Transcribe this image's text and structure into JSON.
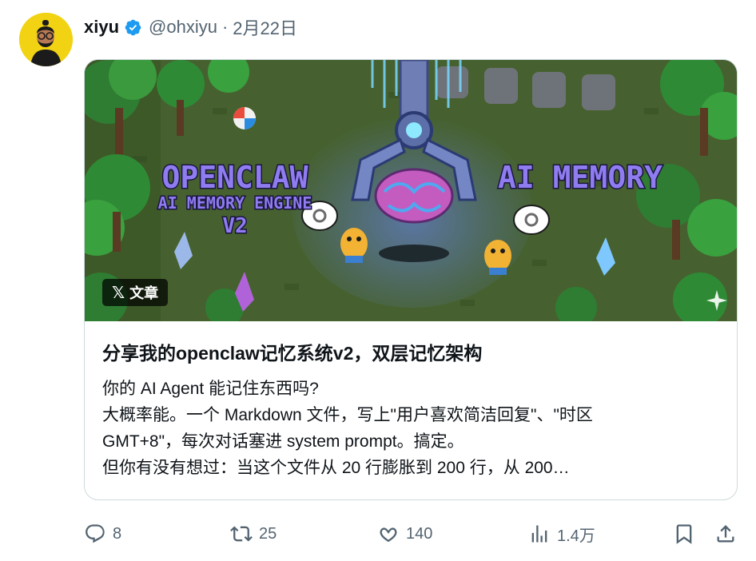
{
  "author": {
    "name": "xiyu",
    "handle": "@ohxiyu",
    "separator": "·",
    "date": "2月22日",
    "verified": true
  },
  "card": {
    "badge": {
      "icon": "x-logo-icon",
      "label": "文章"
    },
    "banner_text": {
      "left_title": "OPENCLAW",
      "left_subtitle": "AI MEMORY ENGINE",
      "left_version": "V2",
      "right_title": "AI MEMORY"
    },
    "title": "分享我的openclaw记忆系统v2，双层记忆架构",
    "body_lines": [
      "你的 AI Agent 能记住东西吗?",
      "大概率能。一个 Markdown 文件，写上\"用户喜欢简洁回复\"、\"时区",
      "GMT+8\"，每次对话塞进 system prompt。搞定。",
      "但你有没有想过：当这个文件从 20 行膨胀到 200 行，从 200…"
    ]
  },
  "actions": {
    "reply": {
      "icon": "reply-icon",
      "count": "8"
    },
    "repost": {
      "icon": "repost-icon",
      "count": "25"
    },
    "like": {
      "icon": "heart-icon",
      "count": "140"
    },
    "views": {
      "icon": "views-chart-icon",
      "count": "1.4万"
    },
    "bookmark": {
      "icon": "bookmark-icon"
    },
    "share": {
      "icon": "share-icon"
    }
  },
  "colors": {
    "text": "#0f1419",
    "secondary": "#536471",
    "verified_blue": "#1d9bf0",
    "border": "#cfd9de",
    "banner_title_purple": "#8f7cf0"
  }
}
